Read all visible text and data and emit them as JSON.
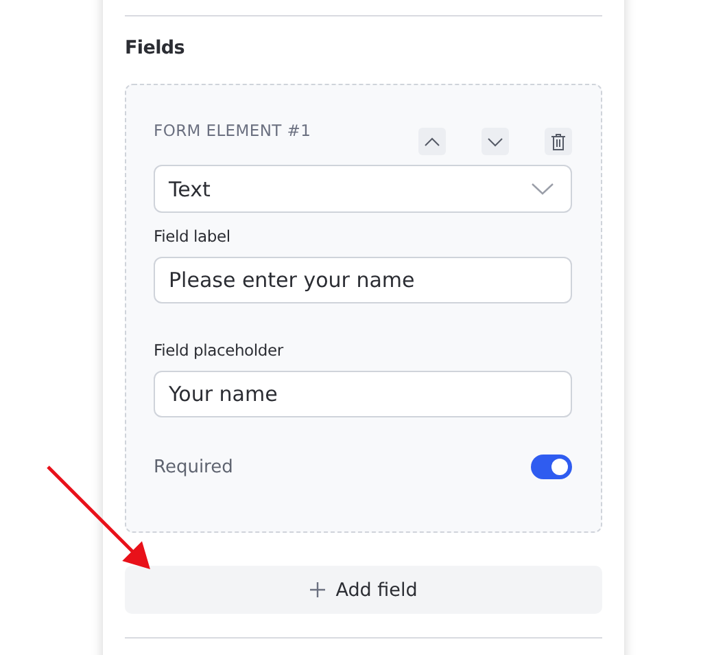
{
  "section": {
    "title": "Fields"
  },
  "form_elements": [
    {
      "title": "FORM ELEMENT #1",
      "type_select": {
        "value": "Text"
      },
      "fields": [
        {
          "label": "Field label",
          "value": "Please enter your name"
        },
        {
          "label": "Field placeholder",
          "value": "Your name"
        }
      ],
      "required": {
        "label": "Required",
        "on": true
      }
    }
  ],
  "add_button": {
    "label": "Add field"
  },
  "annotation": {
    "kind": "arrow"
  }
}
